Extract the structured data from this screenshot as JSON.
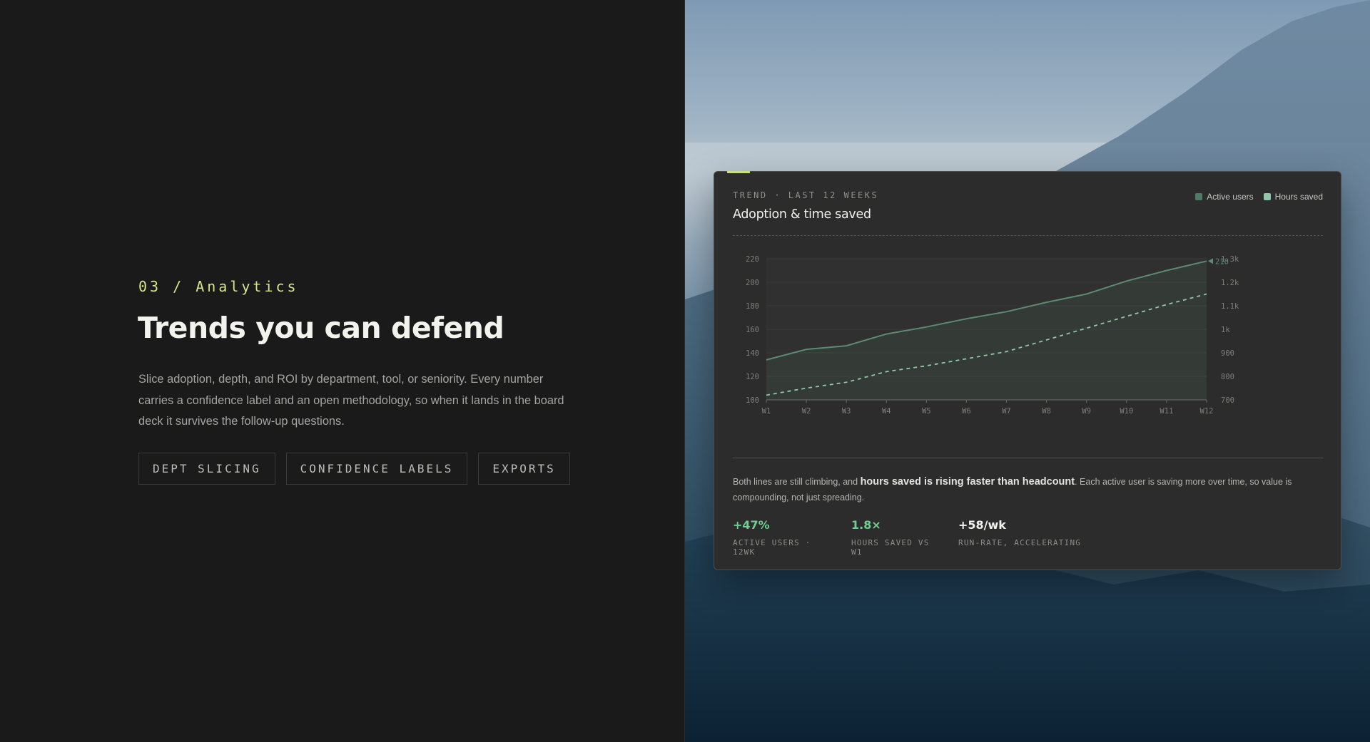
{
  "left": {
    "eyebrow": "03 / Analytics",
    "headline": "Trends you can defend",
    "body": "Slice adoption, depth, and ROI by department, tool, or seniority. Every number carries a confidence label and an open methodology, so when it lands in the board deck it survives the follow-up questions.",
    "tags": [
      "DEPT SLICING",
      "CONFIDENCE LABELS",
      "EXPORTS"
    ]
  },
  "card": {
    "kicker": "TREND · LAST 12 WEEKS",
    "title": "Adoption & time saved",
    "legend": [
      {
        "label": "Active users",
        "color": "#4e7a66"
      },
      {
        "label": "Hours saved",
        "color": "#8fc7a8"
      }
    ],
    "summary_pre": "Both lines are still climbing, and ",
    "summary_strong": "hours saved is rising faster than headcount",
    "summary_post": ". Each active user is saving more over time, so value is compounding, not just spreading.",
    "stats": [
      {
        "value": "+47%",
        "label": "ACTIVE USERS · 12WK",
        "color": "#6fcf8f"
      },
      {
        "value": "1.8×",
        "label": "HOURS SAVED VS W1",
        "color": "#6fcf8f"
      },
      {
        "value": "+58/wk",
        "label": "RUN-RATE, ACCELERATING",
        "color": "#f2f2ee"
      }
    ]
  },
  "chart_data": {
    "type": "line",
    "categories": [
      "W1",
      "W2",
      "W3",
      "W4",
      "W5",
      "W6",
      "W7",
      "W8",
      "W9",
      "W10",
      "W11",
      "W12"
    ],
    "series": [
      {
        "name": "Active users",
        "axis": "left",
        "style": "solid",
        "color": "#5d8a72",
        "values": [
          134,
          143,
          146,
          156,
          162,
          169,
          175,
          183,
          190,
          201,
          210,
          218
        ]
      },
      {
        "name": "Hours saved",
        "axis": "right",
        "style": "dashed",
        "color": "#8fc7a8",
        "values": [
          720,
          750,
          775,
          820,
          845,
          875,
          905,
          955,
          1005,
          1055,
          1105,
          1150
        ]
      }
    ],
    "ylim_left": [
      100,
      220
    ],
    "yticks_left": [
      "100",
      "120",
      "140",
      "160",
      "180",
      "200",
      "220"
    ],
    "ylim_right": [
      700,
      1300
    ],
    "yticks_right": [
      "700",
      "800",
      "900",
      "1k",
      "1.1k",
      "1.2k",
      "1.3k"
    ],
    "end_label": "218",
    "grid": true,
    "legend_placement": "top-right"
  }
}
